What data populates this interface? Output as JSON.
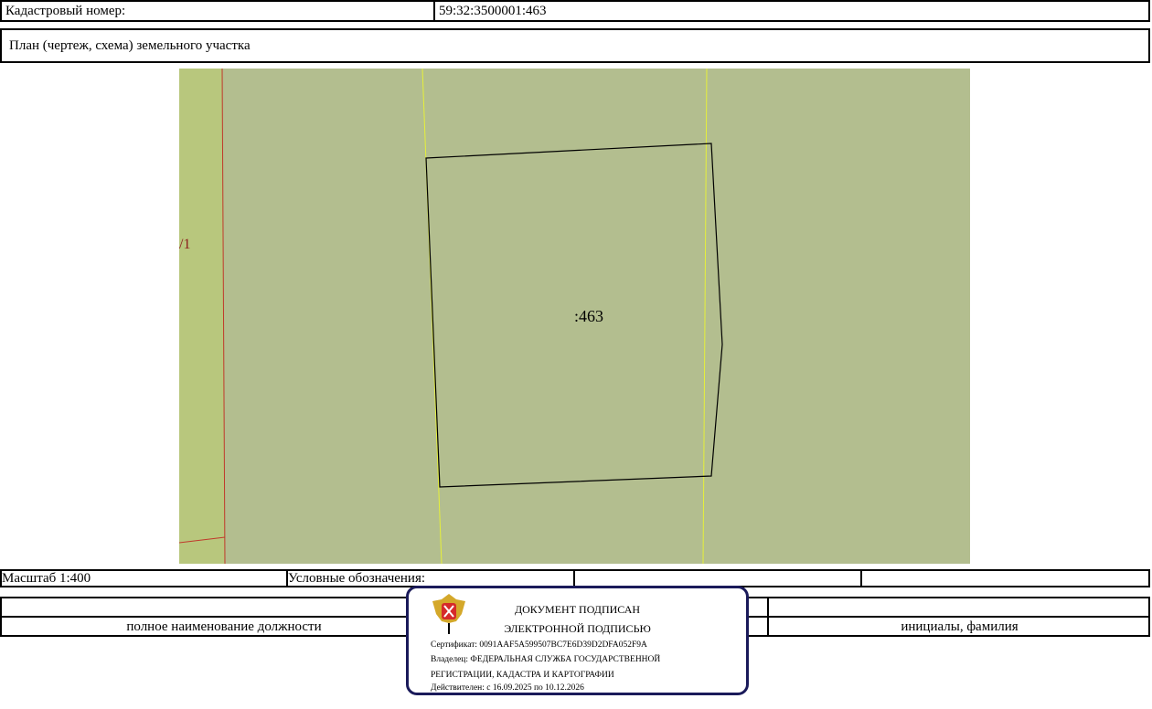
{
  "header": {
    "cadastral_label": "Кадастровый номер:",
    "cadastral_value": "59:32:3500001:463"
  },
  "plan": {
    "title": "План (чертеж, схема) земельного участка",
    "parcel_label": ":463",
    "neighbor_label": "/1"
  },
  "footer": {
    "scale": "Масштаб 1:400",
    "legend": "Условные обозначения:",
    "position_caption": "полное наименование должности",
    "name_caption": "инициалы, фамилия"
  },
  "stamp": {
    "line1": "ДОКУМЕНТ ПОДПИСАН",
    "line2": "ЭЛЕКТРОННОЙ ПОДПИСЬЮ",
    "certificate": "Сертификат: 0091AAF5A599507BC7E6D39D2DFA052F9A",
    "owner1": "Владелец: ФЕДЕРАЛЬНАЯ СЛУЖБА ГОСУДАРСТВЕННОЙ",
    "owner2": "РЕГИСТРАЦИИ, КАДАСТРА И КАРТОГРАФИИ",
    "valid": "Действителен: с 16.09.2025 по 10.12.2026"
  },
  "colors": {
    "map_bg": "#b3be8f",
    "strip": "#b8c77d",
    "boundary_yellow": "#e6f03a",
    "boundary_red": "#c0392b",
    "stamp_border": "#1a1a5a"
  }
}
